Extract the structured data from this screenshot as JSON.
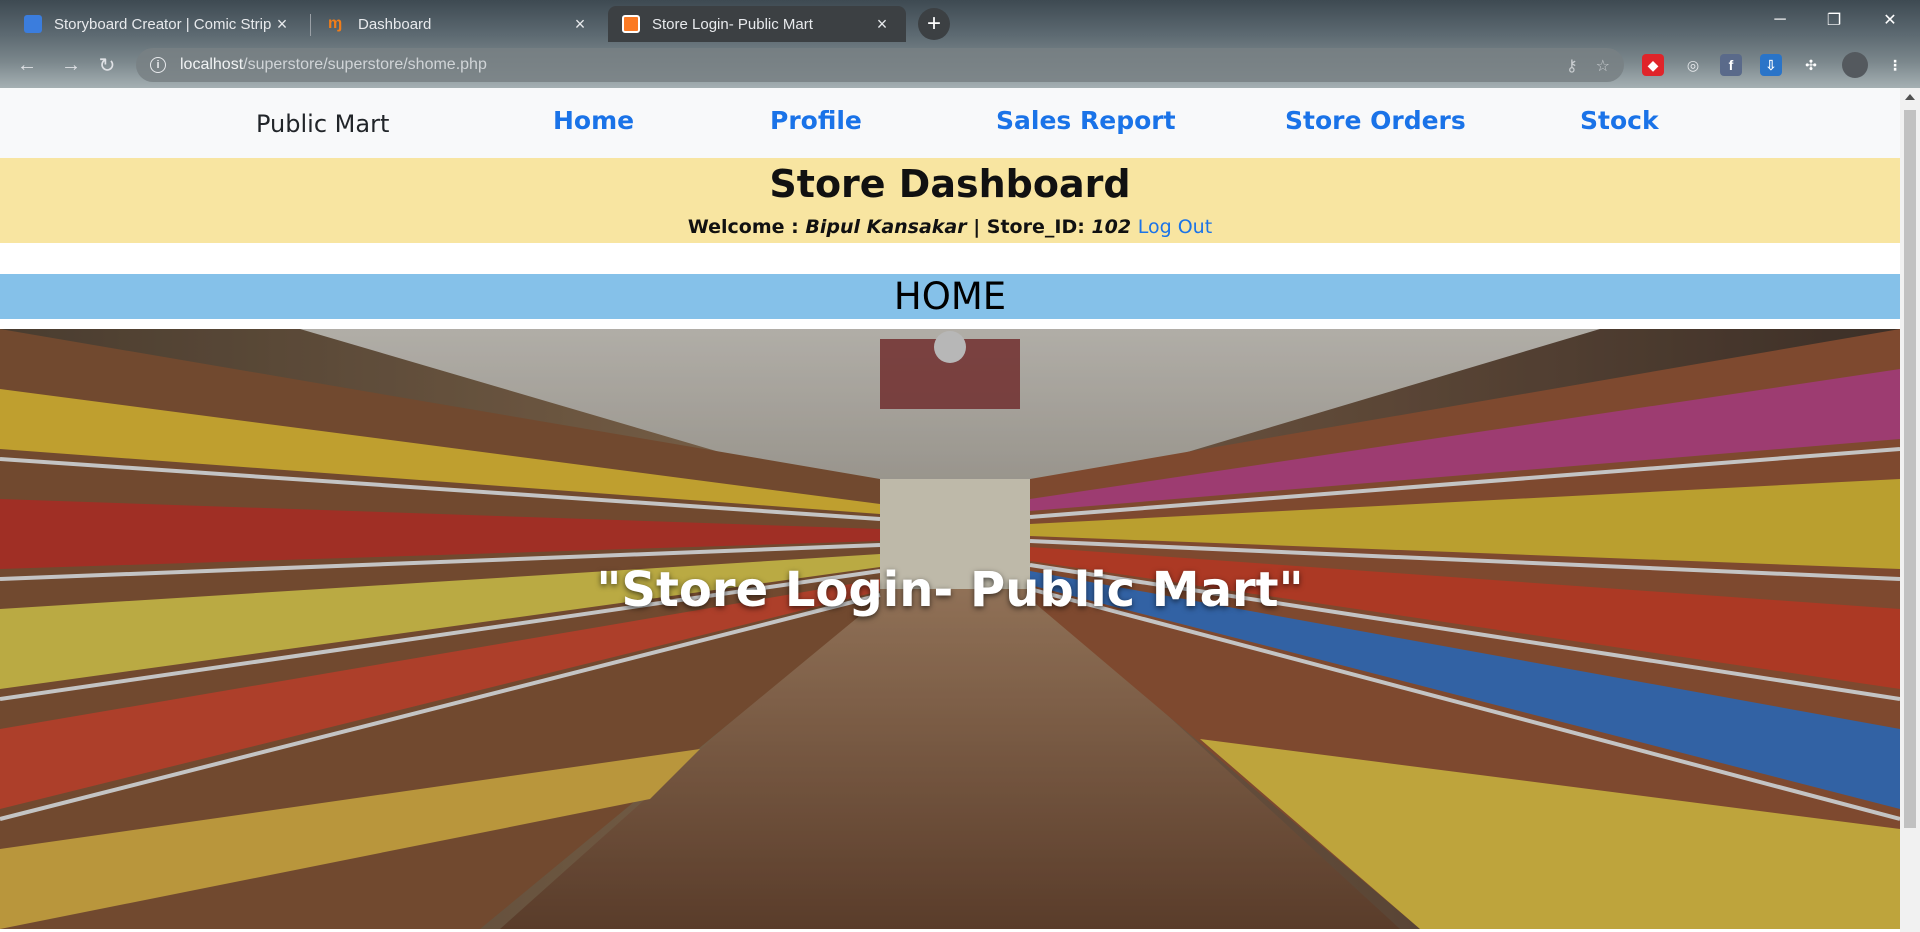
{
  "browser": {
    "tabs": [
      {
        "title": "Storyboard Creator | Comic Strip",
        "active": false,
        "favicon": "storyboard-icon"
      },
      {
        "title": "Dashboard",
        "active": false,
        "favicon": "dashboard-icon"
      },
      {
        "title": "Store Login- Public Mart",
        "active": true,
        "favicon": "xampp-icon"
      }
    ],
    "url_host": "localhost",
    "url_path": "/superstore/superstore/shome.php",
    "new_tab": "+",
    "minimize": "─",
    "restore": "❐",
    "close": "✕"
  },
  "nav": {
    "brand": "Public Mart",
    "links": [
      "Home",
      "Profile",
      "Sales Report",
      "Store Orders",
      "Stock"
    ]
  },
  "dashboard": {
    "title": "Store Dashboard",
    "welcome_label": "Welcome : ",
    "user_name": "Bipul Kansakar",
    "store_label": " | Store_ID: ",
    "store_id": "102",
    "logout": "Log Out"
  },
  "section": {
    "heading": "HOME"
  },
  "hero": {
    "text": "\"Store Login- Public Mart\""
  },
  "colors": {
    "link": "#1a73e8",
    "header_bg": "#f8e5a1",
    "home_bar_bg": "#85c1e9",
    "nav_bg": "#f8f9fa"
  }
}
